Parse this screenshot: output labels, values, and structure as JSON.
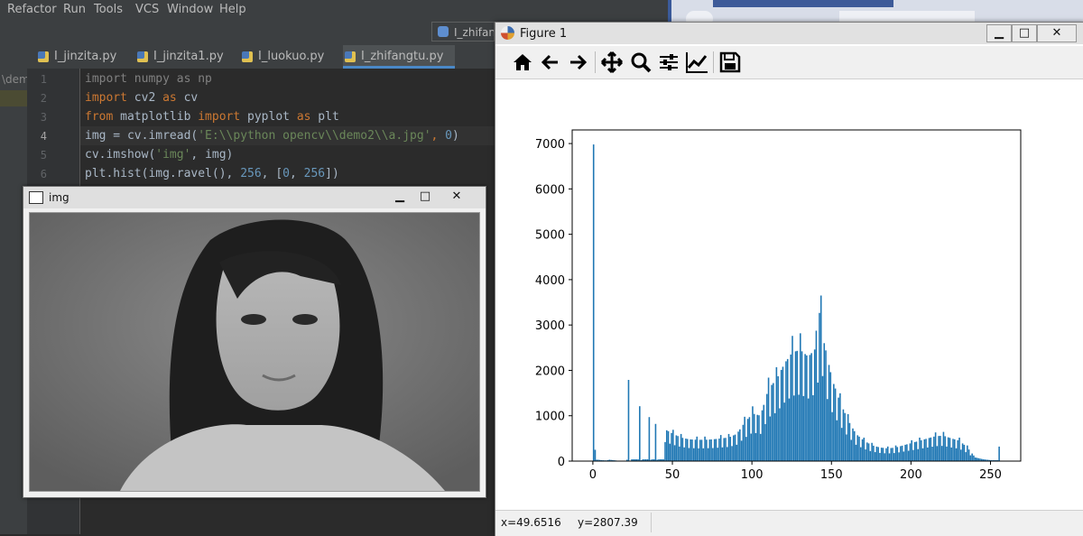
{
  "ide": {
    "menu": [
      "Refactor",
      "Run",
      "Tools",
      "VCS",
      "Window",
      "Help"
    ],
    "run_config": "I_zhifan",
    "tabs": [
      {
        "label": "I_jinzita.py"
      },
      {
        "label": "I_jinzita1.py"
      },
      {
        "label": "I_luokuo.py"
      },
      {
        "label": "I_zhifangtu.py"
      }
    ],
    "project_path": "\\dem",
    "line_numbers": [
      "1",
      "2",
      "3",
      "4",
      "5",
      "6"
    ]
  },
  "code": {
    "l1_kw": "import",
    "l1_rest": " numpy as np",
    "l2_kw": "import",
    "l2_mid": " cv2 ",
    "l2_as": "as",
    "l2_rest": " cv",
    "l3_from": "from",
    "l3_mod": " matplotlib ",
    "l3_imp": "import",
    "l3_mid": " pyplot ",
    "l3_as": "as",
    "l3_rest": " plt",
    "l4_a": "img = cv.imread(",
    "l4_str": "'E:\\\\python opencv\\\\demo2\\\\a.jpg'",
    "l4_comma": ", ",
    "l4_num": "0",
    "l4_end": ")",
    "l5_a": "cv.imshow(",
    "l5_str": "'img'",
    "l5_end": ", img)",
    "l6_a": "plt.hist(img.ravel(), ",
    "l6_n1": "256",
    "l6_b": ", [",
    "l6_n2": "0",
    "l6_c": ", ",
    "l6_n3": "256",
    "l6_end": "])"
  },
  "img_window": {
    "title": "img",
    "minimize": "▁",
    "maximize": "□",
    "close": "✕"
  },
  "figure": {
    "title": "Figure 1",
    "minimize": "▁",
    "maximize": "□",
    "close": "✕",
    "toolbar_icons": [
      "home-icon",
      "back-arrow-icon",
      "forward-arrow-icon",
      "pan-icon",
      "zoom-icon",
      "subplots-icon",
      "edit-curves-icon",
      "save-icon"
    ],
    "status_x": "x=49.6516",
    "status_y": "y=2807.39"
  },
  "chart_data": {
    "type": "bar",
    "xlim": [
      -13,
      269
    ],
    "ylim": [
      0,
      7300
    ],
    "xticks": [
      0,
      50,
      100,
      150,
      200,
      250
    ],
    "yticks": [
      0,
      1000,
      2000,
      3000,
      4000,
      5000,
      6000,
      7000
    ],
    "color": "#1f77b4",
    "peaks": [
      {
        "x": 0,
        "y": 6980
      },
      {
        "x": 1,
        "y": 250
      },
      {
        "x": 22,
        "y": 1790
      },
      {
        "x": 29,
        "y": 1210
      },
      {
        "x": 35,
        "y": 970
      },
      {
        "x": 39,
        "y": 820
      },
      {
        "x": 100,
        "y": 1050
      },
      {
        "x": 143,
        "y": 3650
      },
      {
        "x": 145,
        "y": 2600
      },
      {
        "x": 255,
        "y": 320
      }
    ],
    "bins_profile": [
      [
        0,
        6980
      ],
      [
        1,
        250
      ],
      [
        2,
        40
      ],
      [
        3,
        30
      ],
      [
        5,
        20
      ],
      [
        8,
        15
      ],
      [
        10,
        30
      ],
      [
        15,
        10
      ],
      [
        20,
        10
      ],
      [
        22,
        1790
      ],
      [
        23,
        10
      ],
      [
        29,
        1210
      ],
      [
        30,
        20
      ],
      [
        35,
        970
      ],
      [
        36,
        30
      ],
      [
        39,
        820
      ],
      [
        40,
        30
      ],
      [
        45,
        700
      ],
      [
        50,
        600
      ],
      [
        55,
        520
      ],
      [
        60,
        480
      ],
      [
        65,
        470
      ],
      [
        70,
        470
      ],
      [
        75,
        480
      ],
      [
        80,
        500
      ],
      [
        85,
        520
      ],
      [
        90,
        600
      ],
      [
        95,
        850
      ],
      [
        100,
        1050
      ],
      [
        105,
        1000
      ],
      [
        110,
        1600
      ],
      [
        115,
        1800
      ],
      [
        120,
        2150
      ],
      [
        125,
        2400
      ],
      [
        130,
        2450
      ],
      [
        135,
        2300
      ],
      [
        140,
        2500
      ],
      [
        143,
        3650
      ],
      [
        145,
        2600
      ],
      [
        150,
        1800
      ],
      [
        155,
        1300
      ],
      [
        160,
        900
      ],
      [
        165,
        600
      ],
      [
        170,
        450
      ],
      [
        175,
        350
      ],
      [
        180,
        300
      ],
      [
        185,
        280
      ],
      [
        190,
        300
      ],
      [
        195,
        350
      ],
      [
        200,
        400
      ],
      [
        205,
        450
      ],
      [
        210,
        500
      ],
      [
        215,
        550
      ],
      [
        220,
        560
      ],
      [
        225,
        500
      ],
      [
        230,
        450
      ],
      [
        235,
        300
      ],
      [
        240,
        80
      ],
      [
        245,
        40
      ],
      [
        250,
        20
      ],
      [
        254,
        20
      ],
      [
        255,
        320
      ]
    ]
  }
}
